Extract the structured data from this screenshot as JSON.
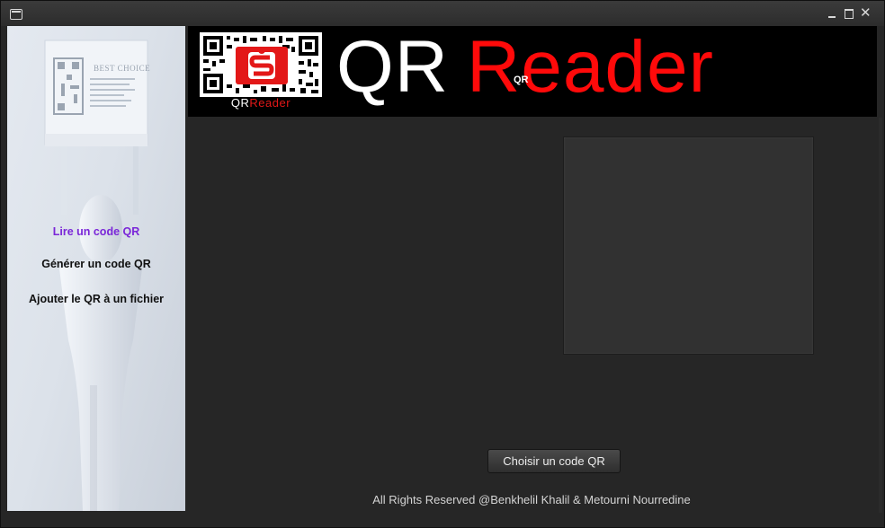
{
  "window": {
    "controls": {
      "minimize_icon": "minimize-icon",
      "maximize_icon": "maximize-icon",
      "close_glyph": "✕"
    }
  },
  "sidebar": {
    "items": [
      {
        "label": "Lire un code QR",
        "active": true
      },
      {
        "label": "Générer un code QR",
        "active": false
      },
      {
        "label": "Ajouter le QR à un fichier",
        "active": false
      }
    ],
    "poster_text": "BEST CHOICE"
  },
  "banner": {
    "logo_caption_a": "QR",
    "logo_caption_b": "Reader",
    "title_a": "QR",
    "title_small": "QR",
    "title_b": "Reader"
  },
  "main": {
    "choose_button_label": "Choisir un code QR",
    "footer_text": "All Rights Reserved @Benkhelil Khalil & Metourni Nourredine"
  },
  "colors": {
    "accent_active": "#7a26d8",
    "banner_red": "#ff0a0a",
    "background": "#262626"
  }
}
